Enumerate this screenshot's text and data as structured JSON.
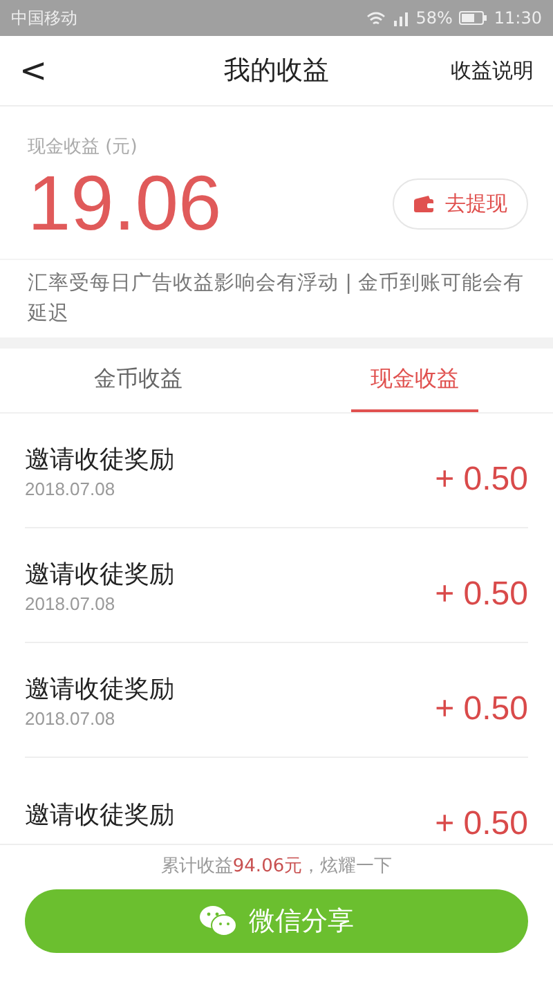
{
  "status_bar": {
    "carrier": "中国移动",
    "battery": "58%",
    "time": "11:30"
  },
  "header": {
    "back": "<",
    "title": "我的收益",
    "action": "收益说明"
  },
  "balance": {
    "label": "现金收益 (元)",
    "amount": "19.06",
    "withdraw_button": "去提现"
  },
  "notice": "汇率受每日广告收益影响会有浮动 | 金币到账可能会有延迟",
  "tabs": [
    {
      "label": "金币收益",
      "selected": false
    },
    {
      "label": "现金收益",
      "selected": true
    }
  ],
  "records": [
    {
      "title": "邀请收徒奖励",
      "date": "2018.07.08",
      "amount": "+ 0.50"
    },
    {
      "title": "邀请收徒奖励",
      "date": "2018.07.08",
      "amount": "+ 0.50"
    },
    {
      "title": "邀请收徒奖励",
      "date": "2018.07.08",
      "amount": "+ 0.50"
    },
    {
      "title": "邀请收徒奖励",
      "amount": "+ 0.50"
    }
  ],
  "footer": {
    "total_prefix": "累计收益",
    "total_amount": "94.06元",
    "total_suffix": "，炫耀一下",
    "share_button": "微信分享"
  }
}
